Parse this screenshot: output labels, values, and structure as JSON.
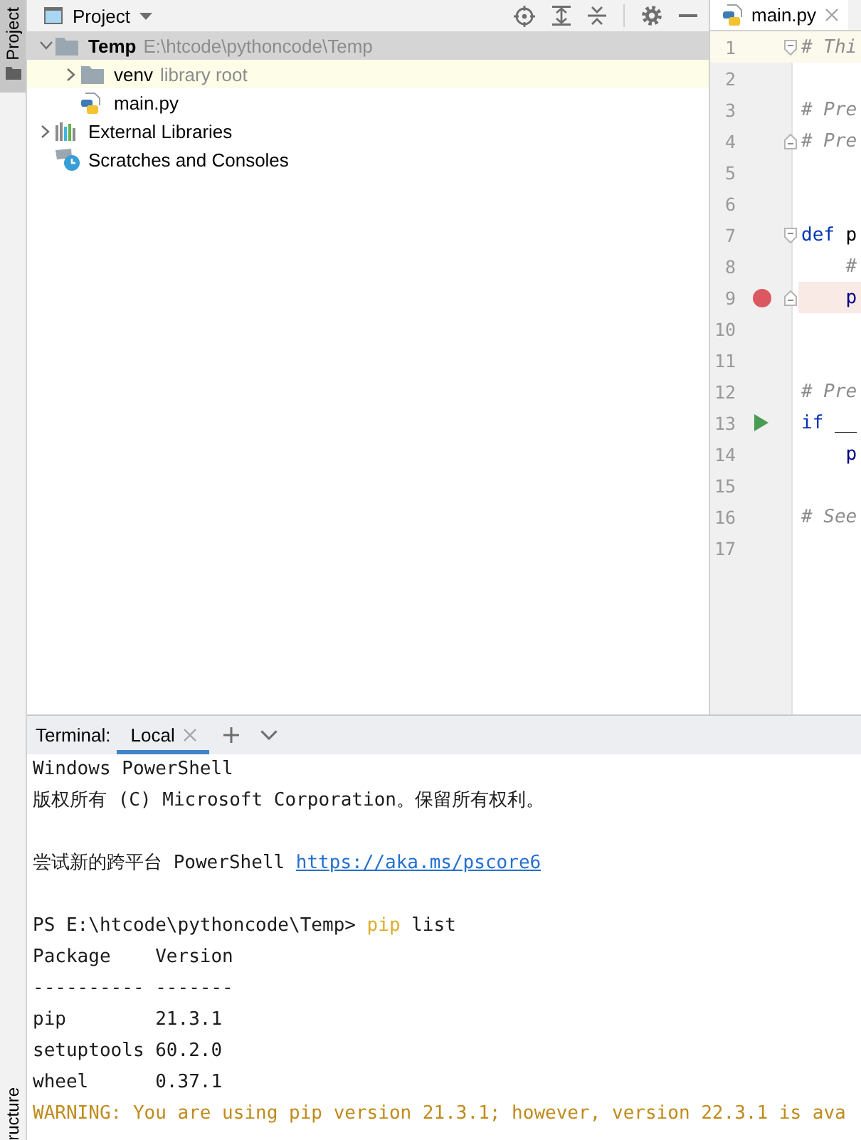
{
  "sidebar_tabs": [
    {
      "label": "Project",
      "selected": true
    },
    {
      "label": "ructure",
      "selected": false
    }
  ],
  "project_panel": {
    "title": "Project",
    "tree": [
      {
        "label": "Temp",
        "hint": "E:\\htcode\\pythoncode\\Temp",
        "kind": "project-root",
        "expanded": true,
        "selected": true,
        "children": [
          {
            "label": "venv",
            "hint": "library root",
            "kind": "library-folder",
            "expanded": false,
            "selected": false
          },
          {
            "label": "main.py",
            "kind": "python-file",
            "selected": false
          }
        ]
      },
      {
        "label": "External Libraries",
        "kind": "libraries",
        "expanded": false,
        "selected": false
      },
      {
        "label": "Scratches and Consoles",
        "kind": "scratches",
        "selected": false
      }
    ]
  },
  "editor": {
    "tabs": [
      {
        "label": "main.py",
        "selected": true
      }
    ],
    "lines": [
      {
        "number": "1",
        "code": [
          {
            "text": "# Thi",
            "kind": "comment"
          }
        ],
        "current": true,
        "fold_start": true,
        "fold_end": false,
        "breakpoint": false,
        "run": false
      },
      {
        "number": "2",
        "current": false,
        "fold_start": false,
        "fold_end": false,
        "breakpoint": false,
        "run": false
      },
      {
        "number": "3",
        "code": [
          {
            "text": "# Pre",
            "kind": "comment"
          }
        ],
        "current": false,
        "fold_start": false,
        "fold_end": false,
        "breakpoint": false,
        "run": false
      },
      {
        "number": "4",
        "code": [
          {
            "text": "# Pre",
            "kind": "comment"
          }
        ],
        "current": false,
        "fold_start": false,
        "fold_end": true,
        "breakpoint": false,
        "run": false
      },
      {
        "number": "5",
        "current": false,
        "fold_start": false,
        "fold_end": false,
        "breakpoint": false,
        "run": false
      },
      {
        "number": "6",
        "current": false,
        "fold_start": false,
        "fold_end": false,
        "breakpoint": false,
        "run": false
      },
      {
        "number": "7",
        "code": [
          {
            "text": "def",
            "kind": "keyword"
          },
          {
            "text": " p",
            "kind": "name"
          }
        ],
        "current": false,
        "fold_start": true,
        "fold_end": false,
        "breakpoint": false,
        "run": false
      },
      {
        "number": "8",
        "code": [
          {
            "text": "    #",
            "kind": "comment"
          }
        ],
        "current": false,
        "fold_start": false,
        "fold_end": false,
        "breakpoint": false,
        "run": false
      },
      {
        "number": "9",
        "code": [
          {
            "text": "    p",
            "kind": "builtin"
          }
        ],
        "current": false,
        "fold_start": false,
        "fold_end": true,
        "breakpoint": true,
        "run": false
      },
      {
        "number": "10",
        "current": false,
        "fold_start": false,
        "fold_end": false,
        "breakpoint": false,
        "run": false
      },
      {
        "number": "11",
        "current": false,
        "fold_start": false,
        "fold_end": false,
        "breakpoint": false,
        "run": false
      },
      {
        "number": "12",
        "code": [
          {
            "text": "# Pre",
            "kind": "comment"
          }
        ],
        "current": false,
        "fold_start": false,
        "fold_end": false,
        "breakpoint": false,
        "run": false
      },
      {
        "number": "13",
        "code": [
          {
            "text": "if",
            "kind": "keyword"
          },
          {
            "text": " __",
            "kind": "name"
          }
        ],
        "current": false,
        "fold_start": false,
        "fold_end": false,
        "breakpoint": false,
        "run": true
      },
      {
        "number": "14",
        "code": [
          {
            "text": "    p",
            "kind": "builtin"
          }
        ],
        "current": false,
        "fold_start": false,
        "fold_end": false,
        "breakpoint": false,
        "run": false
      },
      {
        "number": "15",
        "current": false,
        "fold_start": false,
        "fold_end": false,
        "breakpoint": false,
        "run": false
      },
      {
        "number": "16",
        "code": [
          {
            "text": "# See",
            "kind": "comment"
          }
        ],
        "current": false,
        "fold_start": false,
        "fold_end": false,
        "breakpoint": false,
        "run": false
      },
      {
        "number": "17",
        "current": false,
        "fold_start": false,
        "fold_end": false,
        "breakpoint": false,
        "run": false
      }
    ]
  },
  "terminal": {
    "title": "Terminal:",
    "tabs": [
      {
        "label": "Local",
        "selected": true
      }
    ],
    "blocks": [
      [
        {
          "segments": [
            {
              "text": "Windows PowerShell",
              "kind": "plain"
            }
          ]
        },
        {
          "segments": [
            {
              "text": "版权所有 (C) Microsoft Corporation。保留所有权利。",
              "kind": "plain"
            }
          ]
        }
      ],
      [
        {
          "segments": [
            {
              "text": "尝试新的跨平台 PowerShell",
              "kind": "plain"
            },
            {
              "text": "https://aka.ms/pscore6",
              "kind": "link"
            }
          ]
        }
      ],
      [
        {
          "segments": [
            {
              "text": "PS E:\\htcode\\pythoncode\\Temp>",
              "kind": "plain"
            },
            {
              "text": "pip",
              "kind": "command"
            },
            {
              "text": "list",
              "kind": "plain"
            }
          ]
        },
        {
          "segments": [
            {
              "text": "Package    Version",
              "kind": "plain"
            }
          ]
        },
        {
          "segments": [
            {
              "text": "---------- -------",
              "kind": "plain"
            }
          ]
        },
        {
          "segments": [
            {
              "text": "pip        21.3.1",
              "kind": "plain"
            }
          ]
        },
        {
          "segments": [
            {
              "text": "setuptools 60.2.0",
              "kind": "plain"
            }
          ]
        },
        {
          "segments": [
            {
              "text": "wheel      0.37.1",
              "kind": "plain"
            }
          ]
        },
        {
          "segments": [
            {
              "text": "WARNING: You are using pip version 21.3.1; however, version 22.3.1 is ava",
              "kind": "warning"
            }
          ]
        }
      ]
    ]
  }
}
